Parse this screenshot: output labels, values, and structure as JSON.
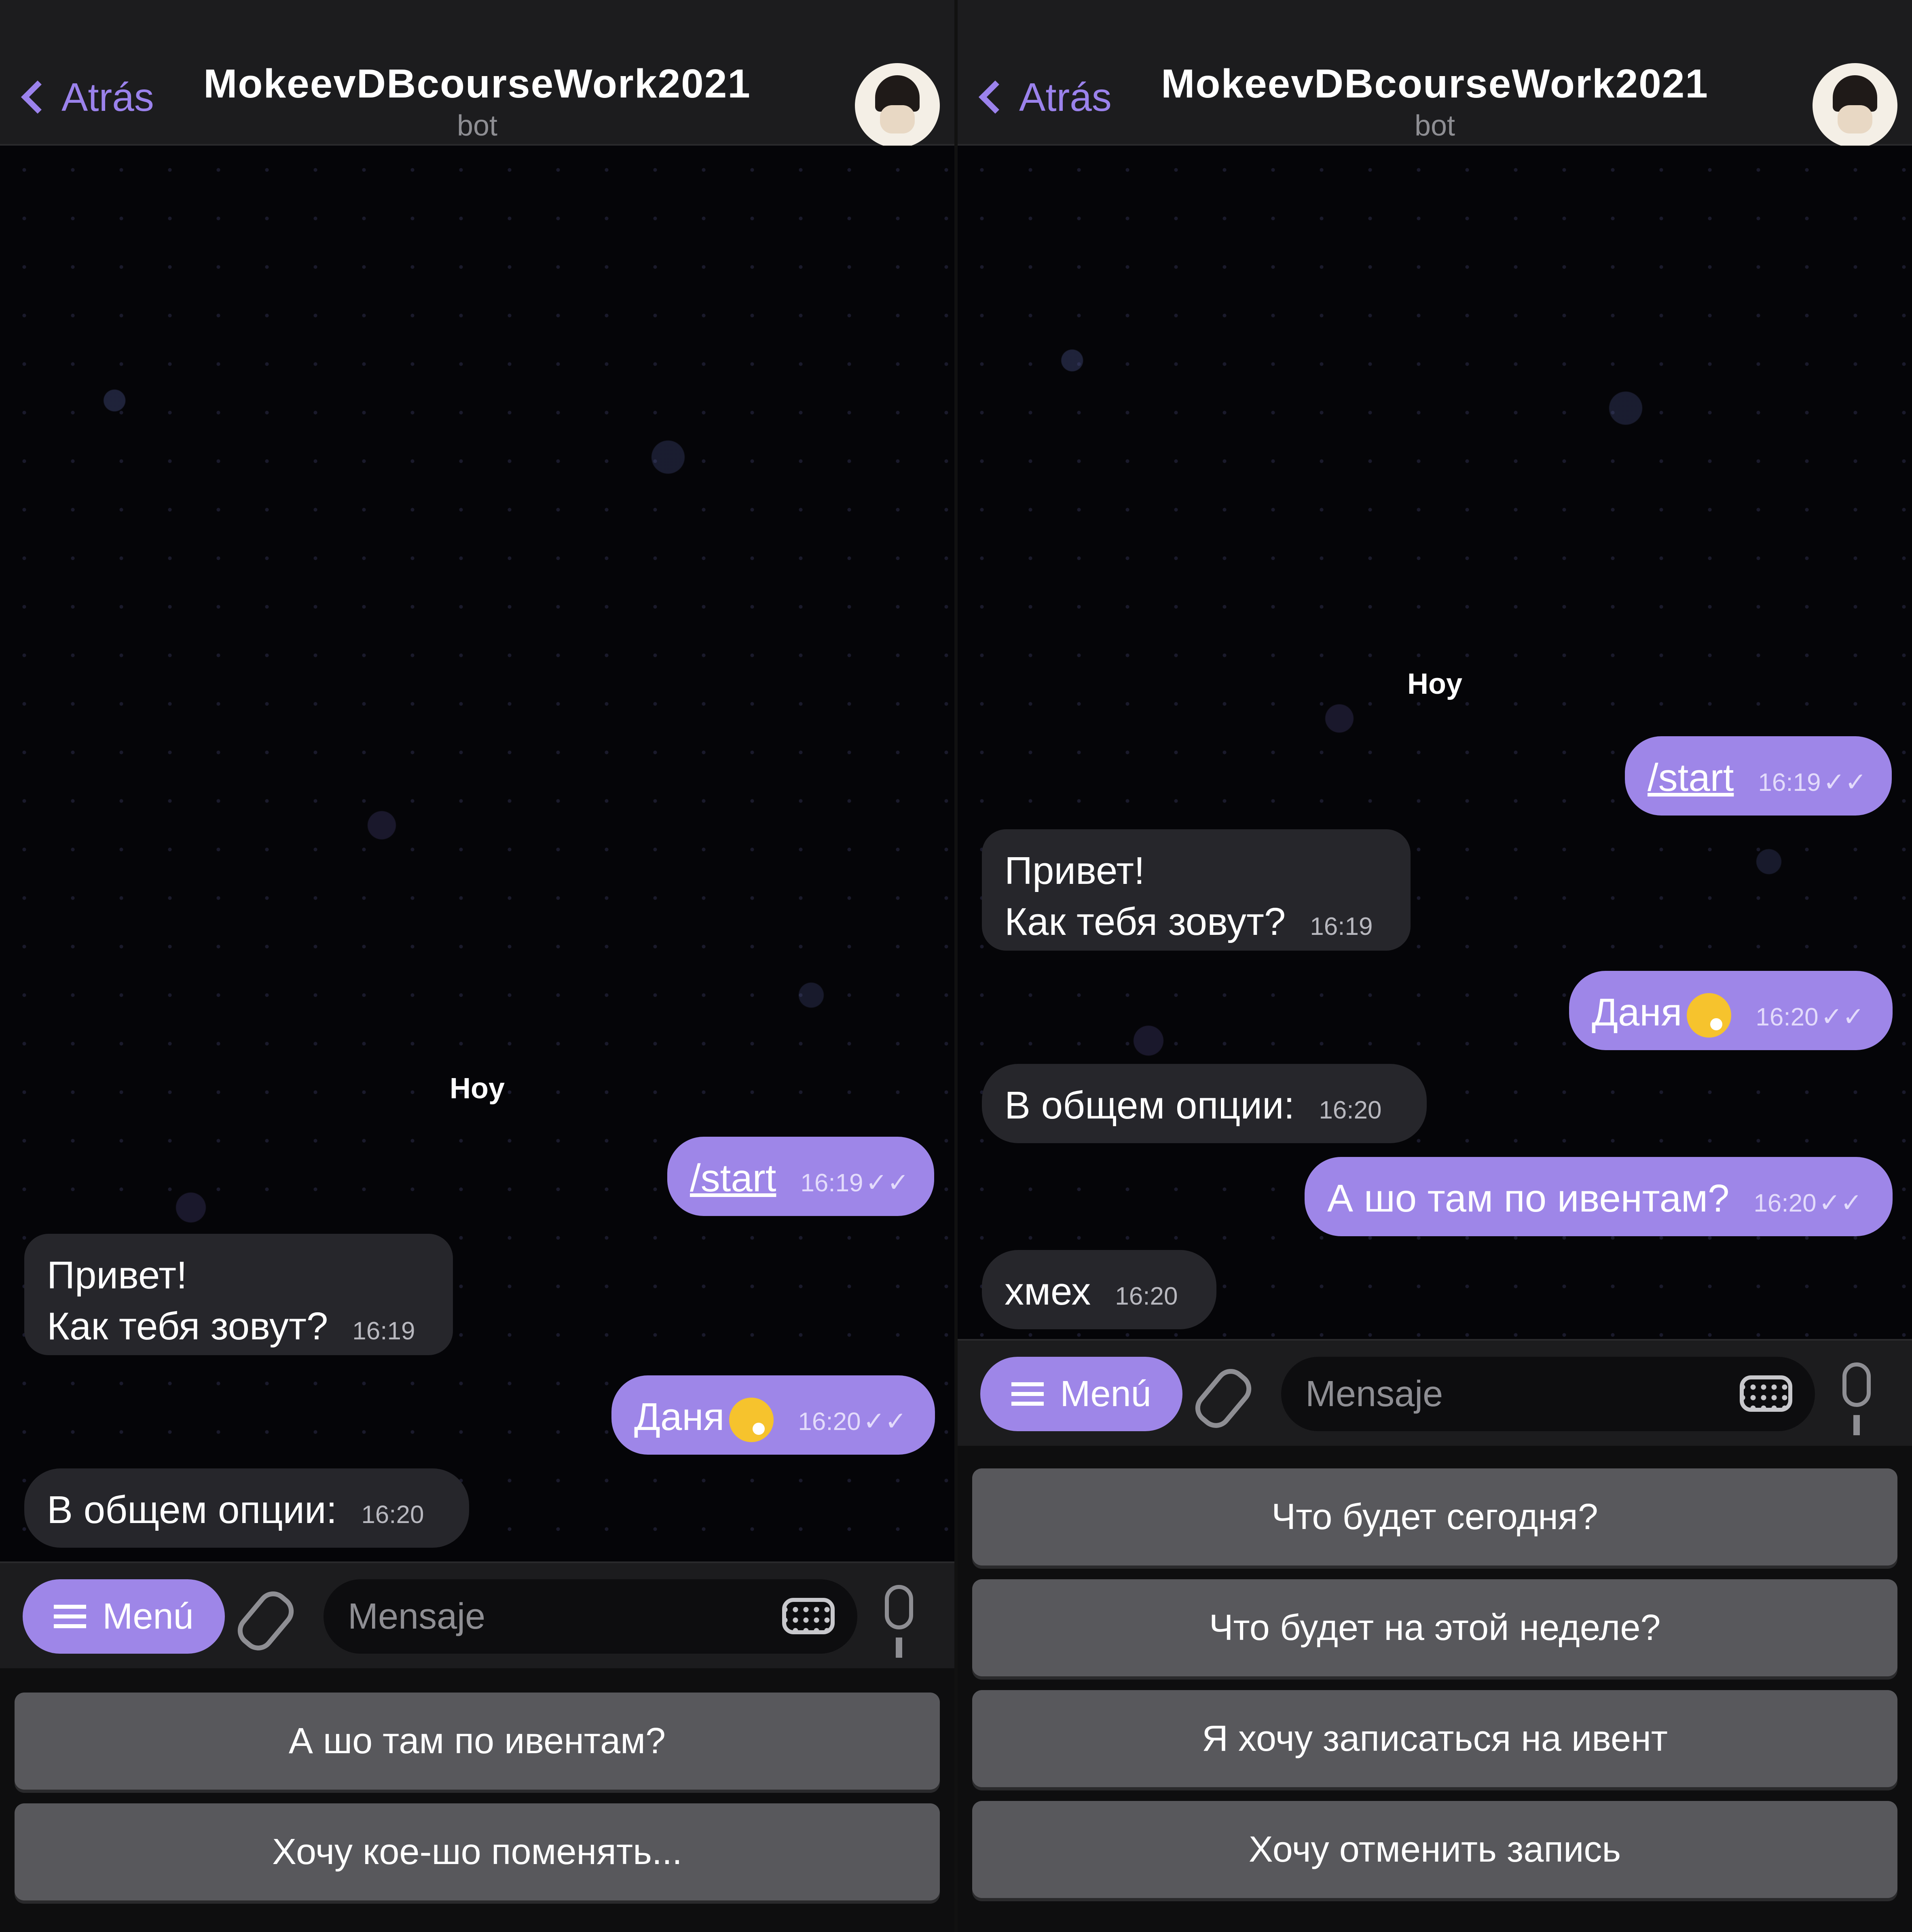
{
  "header": {
    "back_label": "Atrás",
    "title": "MokeevDBcourseWork2021",
    "subtitle": "bot"
  },
  "chat": {
    "date_label": "Hoy",
    "messages": [
      {
        "text": "/start",
        "time": "16:19"
      },
      {
        "line1": "Привет!",
        "line2": "Как тебя зовут?",
        "time": "16:19"
      },
      {
        "text": "Даня",
        "emoji": "tired-face-emoji",
        "time": "16:20"
      },
      {
        "text": "В общем опции:",
        "time": "16:20"
      },
      {
        "text": "А шо там по ивентам?",
        "time": "16:20"
      },
      {
        "text": "хмех",
        "time": "16:20"
      }
    ],
    "check_glyph": "✓✓"
  },
  "input": {
    "menu_label": "Menú",
    "placeholder": "Mensaje"
  },
  "keyboard_left": {
    "buttons": [
      "А шо там по ивентам?",
      "Хочу кое-шо поменять..."
    ]
  },
  "keyboard_right": {
    "buttons": [
      "Что будет сегодня?",
      "Что будет на этой неделе?",
      "Я хочу записаться на ивент",
      "Хочу отменить запись"
    ]
  },
  "colors": {
    "accent": "#9e86e8",
    "incoming_bubble": "#26262b",
    "header_bg": "#1c1c1e",
    "keyboard_button": "#58585c"
  }
}
